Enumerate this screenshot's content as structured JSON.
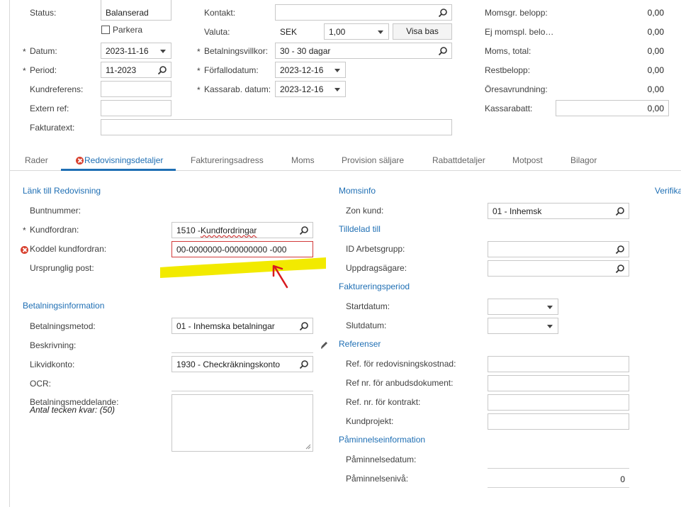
{
  "header": {
    "status_label": "Status:",
    "status_value": "Balanserad",
    "parkera_label": "Parkera",
    "datum_label": "Datum:",
    "datum_value": "2023-11-16",
    "period_label": "Period:",
    "period_value": "11-2023",
    "kundreferens_label": "Kundreferens:",
    "extern_ref_label": "Extern ref:",
    "fakturatext_label": "Fakturatext:",
    "kontakt_label": "Kontakt:",
    "valuta_label": "Valuta:",
    "valuta_code": "SEK",
    "valuta_rate": "1,00",
    "visa_bas_label": "Visa bas",
    "betalningsvillkor_label": "Betalningsvillkor:",
    "betalningsvillkor_value": "30 - 30 dagar",
    "forfallodatum_label": "Förfallodatum:",
    "forfallodatum_value": "2023-12-16",
    "kassarab_datum_label": "Kassarab. datum:",
    "kassarab_datum_value": "2023-12-16",
    "required_mark": "*"
  },
  "totals": {
    "momsgr_label": "Momsgr. belopp:",
    "momsgr_value": "0,00",
    "ej_momspl_label": "Ej momspl. belo…",
    "ej_momspl_value": "0,00",
    "moms_total_label": "Moms, total:",
    "moms_total_value": "0,00",
    "restbelopp_label": "Restbelopp:",
    "restbelopp_value": "0,00",
    "oresavrundning_label": "Öresavrundning:",
    "oresavrundning_value": "0,00",
    "kassarabatt_label": "Kassarabatt:",
    "kassarabatt_value": "0,00"
  },
  "tabs": [
    {
      "label": "Rader"
    },
    {
      "label": "Redovisningsdetaljer"
    },
    {
      "label": "Faktureringsadress"
    },
    {
      "label": "Moms"
    },
    {
      "label": "Provision säljare"
    },
    {
      "label": "Rabattdetaljer"
    },
    {
      "label": "Motpost"
    },
    {
      "label": "Bilagor"
    }
  ],
  "left": {
    "lank_section": "Länk till Redovisning",
    "buntnummer_label": "Buntnummer:",
    "kundfordran_label": "Kundfordran:",
    "kundfordran_value_code": "1510 - ",
    "kundfordran_value_name": "Kundfordringar",
    "koddel_label": "Koddel kundfordran:",
    "koddel_value": "00-0000000-000000000  -000",
    "ursprunglig_label": "Ursprunglig post:",
    "betalning_section": "Betalningsinformation",
    "betalningsmetod_label": "Betalningsmetod:",
    "betalningsmetod_value": "01 - Inhemska betalningar",
    "beskrivning_label": "Beskrivning:",
    "likvidkonto_label": "Likvidkonto:",
    "likvidkonto_value": "1930 - Checkräkningskonto",
    "ocr_label": "OCR:",
    "betalningsmeddelande_label": "Betalningsmeddelande:",
    "antal_tecken_label": "Antal tecken kvar: (50)"
  },
  "middle": {
    "momsinfo_section": "Momsinfo",
    "zon_kund_label": "Zon kund:",
    "zon_kund_value": "01 - Inhemsk",
    "tilldelad_section": "Tilldelad till",
    "id_arbetsgrupp_label": "ID Arbetsgrupp:",
    "uppdragsagare_label": "Uppdragsägare:",
    "faktureringsperiod_section": "Faktureringsperiod",
    "startdatum_label": "Startdatum:",
    "slutdatum_label": "Slutdatum:",
    "referenser_section": "Referenser",
    "ref_redovisning_label": "Ref. för redovisningskostnad:",
    "ref_anbud_label": "Ref nr. för anbudsdokument:",
    "ref_kontrakt_label": "Ref. nr. för kontrakt:",
    "kundprojekt_label": "Kundprojekt:",
    "paminnelse_section": "Påminnelseinformation",
    "paminnelsedatum_label": "Påminnelsedatum:",
    "paminnelseniva_label": "Påminnelsenivå:",
    "paminnelseniva_value": "0"
  },
  "right": {
    "verifika_section": "Verifika"
  },
  "colors": {
    "accent": "#1f6fb4",
    "error": "#d23a3a",
    "highlight": "#f2ea00",
    "arrow": "#d7191f"
  }
}
